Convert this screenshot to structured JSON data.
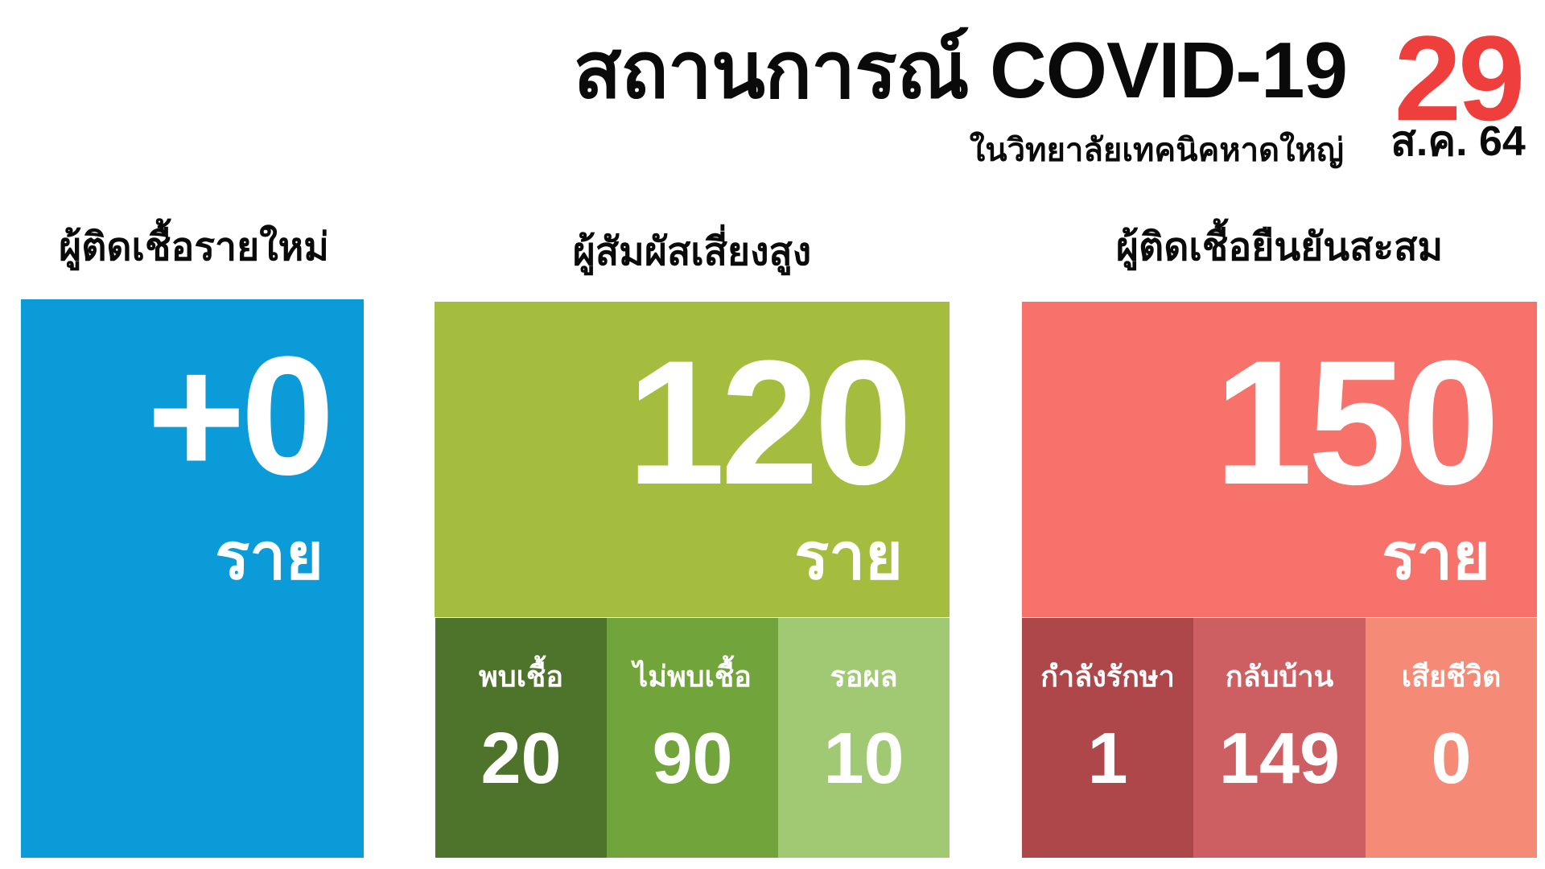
{
  "header": {
    "title": "สถานการณ์ COVID-19",
    "subtitle": "ในวิทยาลัยเทคนิคหาดใหญ่",
    "date_day": "29",
    "date_month_year": "ส.ค. 64"
  },
  "colors": {
    "new_cases": "#0a9bd8",
    "high_risk": "#a5bd3f",
    "high_risk_found": "#4e732a",
    "high_risk_not_found": "#71a53b",
    "high_risk_pending": "#a1c973",
    "confirmed": "#f7726b",
    "confirmed_treating": "#ad474a",
    "confirmed_home": "#cd5e61",
    "confirmed_died": "#f58a77",
    "date_day": "#ee3f3c"
  },
  "new_cases": {
    "label": "ผู้ติดเชื้อรายใหม่",
    "value": "+0",
    "unit": "ราย"
  },
  "high_risk": {
    "label": "ผู้สัมผัสเสี่ยงสูง",
    "value": "120",
    "unit": "ราย",
    "breakdown": [
      {
        "label": "พบเชื้อ",
        "value": "20"
      },
      {
        "label": "ไม่พบเชื้อ",
        "value": "90"
      },
      {
        "label": "รอผล",
        "value": "10"
      }
    ]
  },
  "confirmed": {
    "label": "ผู้ติดเชื้อยืนยันสะสม",
    "value": "150",
    "unit": "ราย",
    "breakdown": [
      {
        "label": "กำลังรักษา",
        "value": "1"
      },
      {
        "label": "กลับบ้าน",
        "value": "149"
      },
      {
        "label": "เสียชีวิต",
        "value": "0"
      }
    ]
  }
}
